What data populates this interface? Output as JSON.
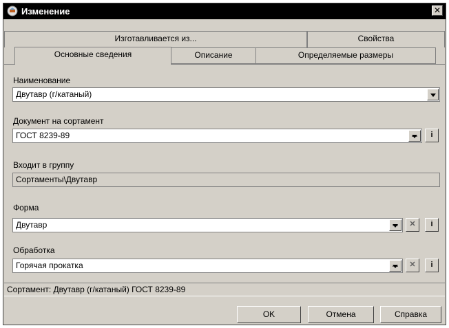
{
  "window": {
    "title": "Изменение"
  },
  "top_tabs": [
    "Изготавливается из...",
    "Свойства"
  ],
  "tabs": [
    "Основные сведения",
    "Описание",
    "Определяемые размеры"
  ],
  "fields": {
    "name": {
      "label": "Наименование",
      "value": "Двутавр (г/катаный)"
    },
    "document": {
      "label": "Документ на сортамент",
      "value": "ГОСТ 8239-89"
    },
    "group": {
      "label": "Входит в группу",
      "value": "Сортаменты\\Двутавр"
    },
    "form": {
      "label": "Форма",
      "value": "Двутавр"
    },
    "processing": {
      "label": "Обработка",
      "value": "Горячая прокатка"
    }
  },
  "status": "Сортамент: Двутавр (г/катаный) ГОСТ 8239-89",
  "buttons": {
    "ok": "OK",
    "cancel": "Отмена",
    "help": "Справка"
  },
  "icons": {
    "ellipsis": "...",
    "info": "i",
    "clear": "x-icon"
  }
}
